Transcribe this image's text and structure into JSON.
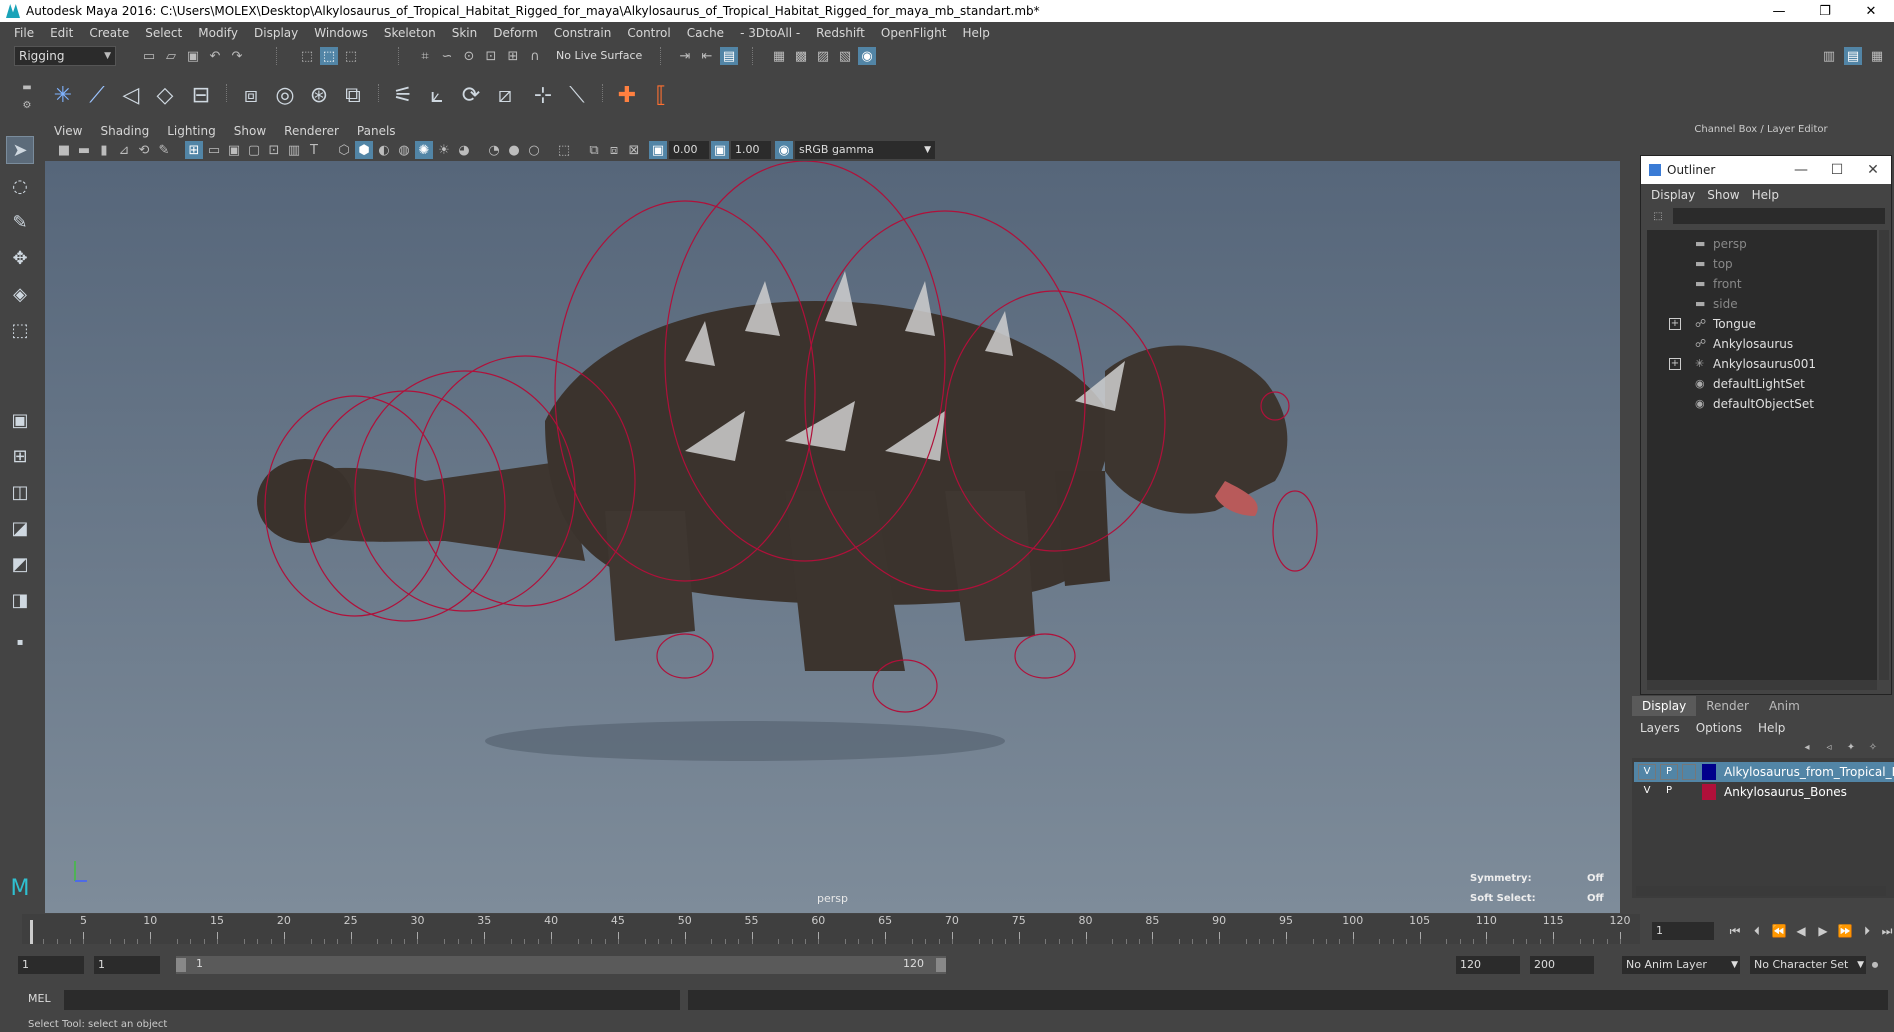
{
  "window": {
    "title": "Autodesk Maya 2016: C:\\Users\\MOLEX\\Desktop\\Alkylosaurus_of_Tropical_Habitat_Rigged_for_maya\\Alkylosaurus_of_Tropical_Habitat_Rigged_for_maya_mb_standart.mb*",
    "minimize": "—",
    "restore": "❐",
    "close": "✕"
  },
  "menubar": [
    "File",
    "Edit",
    "Create",
    "Select",
    "Modify",
    "Display",
    "Windows",
    "Skeleton",
    "Skin",
    "Deform",
    "Constrain",
    "Control",
    "Cache",
    "- 3DtoAll -",
    "Redshift",
    "OpenFlight",
    "Help"
  ],
  "statusline": {
    "mode": "Rigging",
    "live_surface": "No Live Surface"
  },
  "viewport": {
    "menu": [
      "View",
      "Shading",
      "Lighting",
      "Show",
      "Renderer",
      "Panels"
    ],
    "exposure": "0.00",
    "gamma": "1.00",
    "colorspace": "sRGB gamma",
    "camera": "persp",
    "hud": {
      "symmetry_label": "Symmetry:",
      "symmetry_value": "Off",
      "soft_select_label": "Soft Select:",
      "soft_select_value": "Off"
    }
  },
  "channel_box": {
    "title": "Channel Box / Layer Editor"
  },
  "outliner": {
    "title": "Outliner",
    "menu": [
      "Display",
      "Show",
      "Help"
    ],
    "items": [
      {
        "label": "persp",
        "dim": true,
        "icon": "camera-icon",
        "expand": false
      },
      {
        "label": "top",
        "dim": true,
        "icon": "camera-icon",
        "expand": false
      },
      {
        "label": "front",
        "dim": true,
        "icon": "camera-icon",
        "expand": false
      },
      {
        "label": "side",
        "dim": true,
        "icon": "camera-icon",
        "expand": false
      },
      {
        "label": "Tongue",
        "dim": false,
        "icon": "mesh-icon",
        "expand": true
      },
      {
        "label": "Ankylosaurus",
        "dim": false,
        "icon": "mesh-icon",
        "expand": false
      },
      {
        "label": "Ankylosaurus001",
        "dim": false,
        "icon": "joint-icon",
        "expand": true
      },
      {
        "label": "defaultLightSet",
        "dim": false,
        "icon": "set-icon",
        "expand": false
      },
      {
        "label": "defaultObjectSet",
        "dim": false,
        "icon": "set-icon",
        "expand": false
      }
    ]
  },
  "layer_editor": {
    "tabs": [
      "Display",
      "Render",
      "Anim"
    ],
    "menu": [
      "Layers",
      "Options",
      "Help"
    ],
    "layers": [
      {
        "v": "V",
        "p": "P",
        "color": "#00008b",
        "name": "Alkylosaurus_from_Tropical_Hab",
        "selected": true
      },
      {
        "v": "V",
        "p": "P",
        "color": "#b0103a",
        "name": "Ankylosaurus_Bones",
        "selected": false
      }
    ]
  },
  "timeline": {
    "ticks": [
      "1",
      "5",
      "10",
      "15",
      "20",
      "25",
      "30",
      "35",
      "40",
      "45",
      "50",
      "55",
      "60",
      "65",
      "70",
      "75",
      "80",
      "85",
      "90",
      "95",
      "100",
      "105",
      "110",
      "115",
      "120"
    ],
    "current_frame": "1"
  },
  "range": {
    "start": "1",
    "playback_start": "1",
    "slider_start": "1",
    "slider_end": "120",
    "playback_end": "120",
    "end": "200",
    "anim_layer": "No Anim Layer",
    "character_set": "No Character Set"
  },
  "command_line": {
    "label": "MEL"
  },
  "status": {
    "help_line": "Select Tool: select an object"
  }
}
